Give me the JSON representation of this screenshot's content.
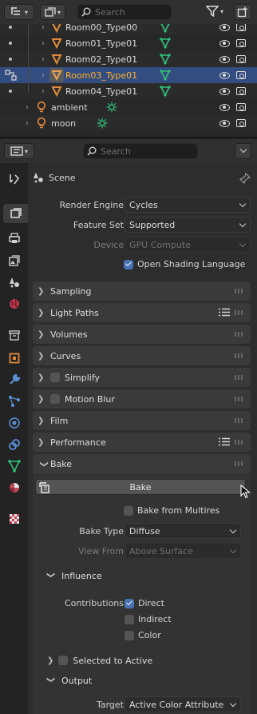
{
  "outliner": {
    "search_placeholder": "Search",
    "rows": [
      {
        "label": "Room00_Type00"
      },
      {
        "label": "Room01_Type01"
      },
      {
        "label": "Room02_Type01"
      },
      {
        "label": "Room03_Type01"
      },
      {
        "label": "Room04_Type01"
      },
      {
        "label": "ambient"
      },
      {
        "label": "moon"
      }
    ]
  },
  "properties": {
    "search_placeholder": "Search",
    "context": "Scene",
    "render_engine": {
      "label": "Render Engine",
      "value": "Cycles"
    },
    "feature_set": {
      "label": "Feature Set",
      "value": "Supported"
    },
    "device": {
      "label": "Device",
      "value": "GPU Compute"
    },
    "osl": {
      "label": "Open Shading Language",
      "checked": true
    },
    "panels": {
      "sampling": "Sampling",
      "light_paths": "Light Paths",
      "volumes": "Volumes",
      "curves": "Curves",
      "simplify": "Simplify",
      "motion_blur": "Motion Blur",
      "film": "Film",
      "performance": "Performance",
      "bake": "Bake"
    },
    "bake": {
      "button": "Bake",
      "from_multires": "Bake from Multires",
      "bake_type": {
        "label": "Bake Type",
        "value": "Diffuse"
      },
      "view_from": {
        "label": "View From",
        "value": "Above Surface"
      },
      "influence": "Influence",
      "contributions": "Contributions",
      "direct": "Direct",
      "indirect": "Indirect",
      "color": "Color",
      "selected_to_active": "Selected to Active",
      "output": "Output",
      "target": {
        "label": "Target",
        "value": "Active Color Attribute"
      }
    }
  },
  "colors": {
    "accent": "#4772b3",
    "selection": "#334d80",
    "active_label": "#ffaf29",
    "mesh_icon": "#e08a3a",
    "vertex_icon": "#2fc27a"
  }
}
